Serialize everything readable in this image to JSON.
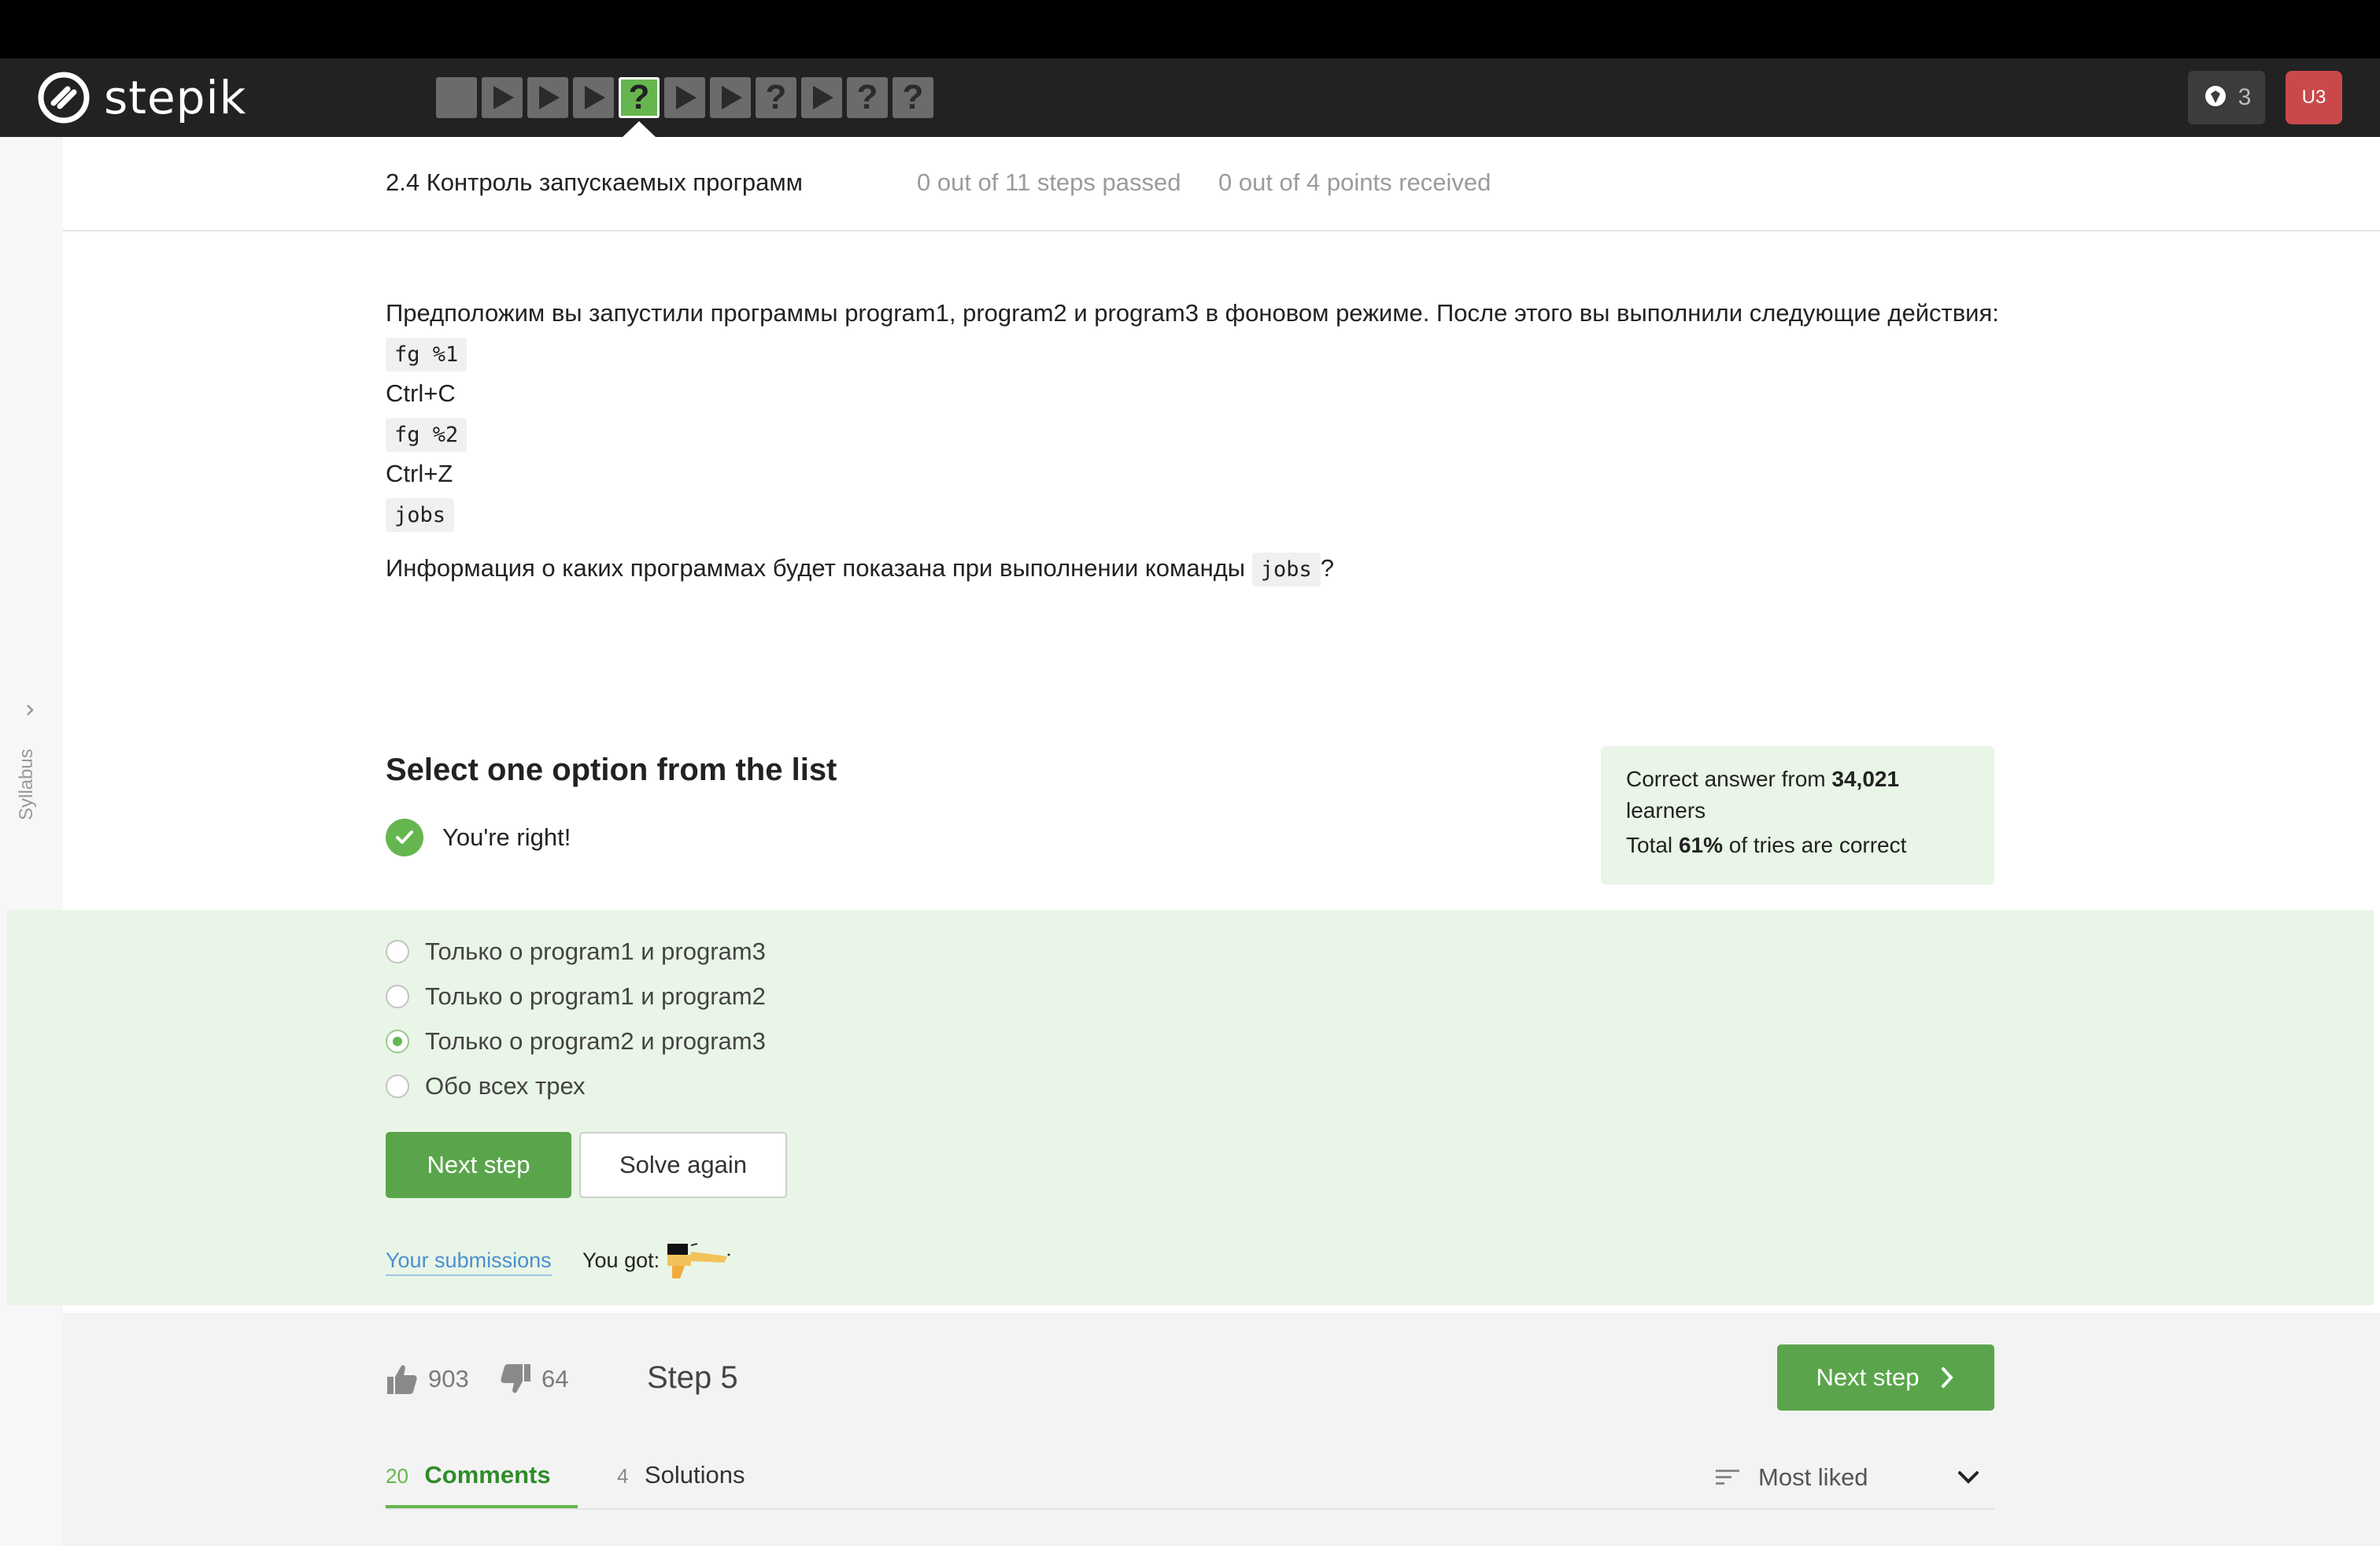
{
  "app": {
    "logo_text": "stepik",
    "brand_color": "#66b64f",
    "header_bg": "#222222"
  },
  "nav": {
    "steps": [
      {
        "kind": "text",
        "icon": "square-icon"
      },
      {
        "kind": "video",
        "icon": "play-icon"
      },
      {
        "kind": "video",
        "icon": "play-icon"
      },
      {
        "kind": "video",
        "icon": "play-icon"
      },
      {
        "kind": "quiz",
        "icon": "question-icon",
        "current": true
      },
      {
        "kind": "video",
        "icon": "play-icon"
      },
      {
        "kind": "video",
        "icon": "play-icon"
      },
      {
        "kind": "quiz",
        "icon": "question-icon"
      },
      {
        "kind": "video",
        "icon": "play-icon"
      },
      {
        "kind": "quiz",
        "icon": "question-icon"
      },
      {
        "kind": "quiz",
        "icon": "question-icon"
      }
    ],
    "notifications_count": "3",
    "avatar_initials": "U3"
  },
  "sidebar": {
    "label": "Syllabus"
  },
  "lesson": {
    "title": "2.4 Контроль запускаемых программ",
    "steps_passed": "0 out of 11 steps passed",
    "points": "0 out of 4 points  received"
  },
  "problem": {
    "intro": "Предположим вы запустили программы program1, program2 и program3 в фоновом режиме. После этого вы выполнили следующие действия:",
    "actions": [
      {
        "type": "code",
        "text": "fg %1"
      },
      {
        "type": "text",
        "text": "Ctrl+C"
      },
      {
        "type": "code",
        "text": "fg %2"
      },
      {
        "type": "text",
        "text": "Ctrl+Z"
      },
      {
        "type": "code",
        "text": "jobs"
      }
    ],
    "question_before": "Информация о каких программах будет показана при выполнении команды",
    "question_code": "jobs",
    "question_after": "?"
  },
  "quiz": {
    "title": "Select one option from the list",
    "result": "You're right!",
    "stats": {
      "line1_prefix": "Correct answer from",
      "learners_count": "34,021",
      "line1_suffix": "learners",
      "line2_prefix": "Total",
      "percent": "61%",
      "line2_suffix": "of tries are correct"
    },
    "options": [
      {
        "label": "Только о program1 и program3",
        "checked": false
      },
      {
        "label": "Только о program1 и program2",
        "checked": false
      },
      {
        "label": "Только о program2 и program3",
        "checked": true
      },
      {
        "label": "Обо всех трех",
        "checked": false
      }
    ],
    "next_step_label": "Next step",
    "solve_again_label": "Solve again",
    "submissions_label": "Your submissions",
    "you_got_label": "You got:"
  },
  "footer": {
    "likes": "903",
    "dislikes": "64",
    "step_label": "Step 5",
    "next_step_label": "Next step",
    "tabs": [
      {
        "count": "20",
        "label": "Comments",
        "active": true
      },
      {
        "count": "4",
        "label": "Solutions",
        "active": false
      }
    ],
    "sort_label": "Most liked"
  }
}
